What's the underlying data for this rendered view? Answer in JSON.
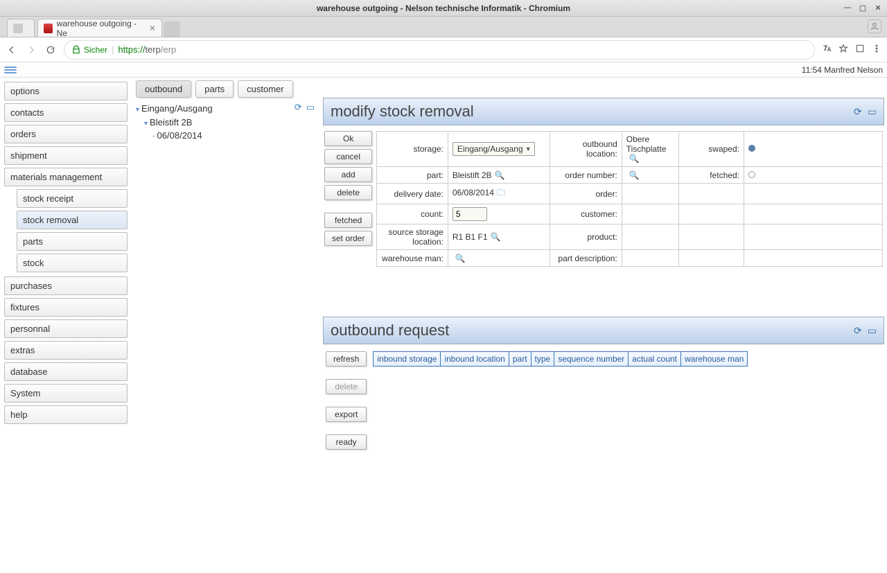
{
  "os": {
    "title": "warehouse outgoing - Nelson technische Informatik - Chromium"
  },
  "browser": {
    "tab_blank_label": "",
    "tab_active_label": "warehouse outgoing - Ne",
    "secure_label": "Sicher",
    "url_proto": "https://",
    "url_host": "terp",
    "url_path": "/erp"
  },
  "appbar": {
    "time": "11:54",
    "user": "Manfred Nelson"
  },
  "sidebar": {
    "items": [
      {
        "label": "options"
      },
      {
        "label": "contacts"
      },
      {
        "label": "orders"
      },
      {
        "label": "shipment"
      },
      {
        "label": "materials management",
        "children": [
          {
            "label": "stock receipt"
          },
          {
            "label": "stock removal",
            "active": true
          },
          {
            "label": "parts"
          },
          {
            "label": "stock"
          }
        ]
      },
      {
        "label": "purchases"
      },
      {
        "label": "fixtures"
      },
      {
        "label": "personnal"
      },
      {
        "label": "extras"
      },
      {
        "label": "database"
      },
      {
        "label": "System"
      },
      {
        "label": "help"
      }
    ]
  },
  "content_tabs": [
    {
      "label": "outbound",
      "active": true
    },
    {
      "label": "parts"
    },
    {
      "label": "customer"
    }
  ],
  "tree": {
    "root": "Eingang/Ausgang",
    "child1": "Bleistift 2B",
    "child2": "06/08/2014"
  },
  "modify": {
    "title": "modify stock removal",
    "buttons": {
      "ok": "Ok",
      "cancel": "cancel",
      "add": "add",
      "delete": "delete",
      "fetched": "fetched",
      "set_order": "set order"
    },
    "labels": {
      "storage": "storage:",
      "part": "part:",
      "delivery_date": "delivery date:",
      "count": "count:",
      "source_location": "source storage location:",
      "warehouse_man": "warehouse man:",
      "outbound_location": "outbound location:",
      "order_number": "order number:",
      "order": "order:",
      "customer": "customer:",
      "product": "product:",
      "part_description": "part description:",
      "swaped": "swaped:",
      "fetched": "fetched:"
    },
    "values": {
      "storage": "Eingang/Ausgang",
      "part": "Bleistift 2B",
      "delivery_date": "06/08/2014",
      "count": "5",
      "source_location": "R1 B1 F1",
      "outbound_location": "Obere Tischplatte"
    }
  },
  "outbound": {
    "title": "outbound request",
    "buttons": {
      "refresh": "refresh",
      "delete": "delete",
      "export": "export",
      "ready": "ready"
    },
    "columns": [
      "inbound storage",
      "inbound location",
      "part",
      "type",
      "sequence number",
      "actual count",
      "warehouse man"
    ]
  }
}
